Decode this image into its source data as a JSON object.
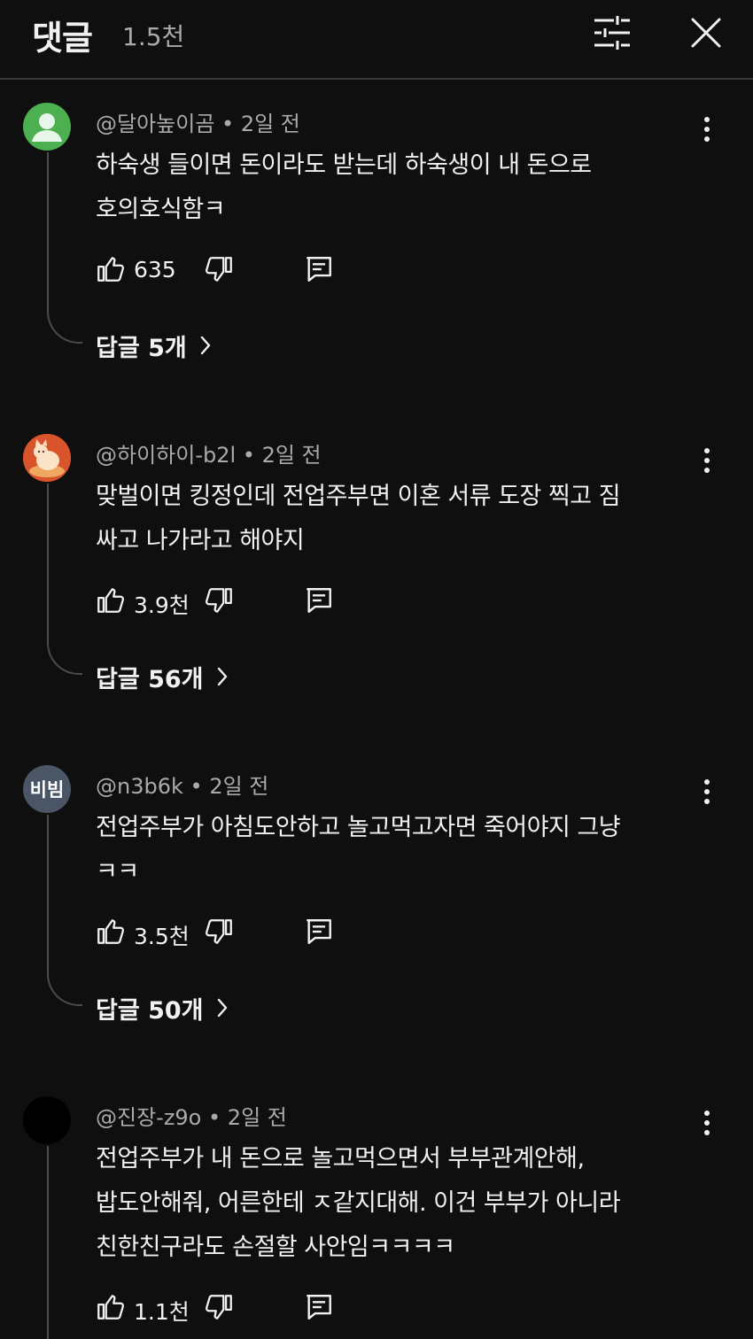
{
  "header": {
    "title": "댓글",
    "count": "1.5천",
    "filter_icon": "sliders-icon",
    "close_icon": "close-icon"
  },
  "comments": [
    {
      "avatar_color": "#4caf50",
      "avatar_kind": "default-person",
      "handle": "@달아높이곰",
      "time": "2일 전",
      "text_lines": [
        "하숙생 들이면 돈이라도 받는데 하숙생이 내 돈으로",
        "호의호식함ㅋ"
      ],
      "likes": "635",
      "replies": "답글 5개"
    },
    {
      "avatar_color": "#d9542b",
      "avatar_kind": "cat-photo",
      "handle": "@하이하이-b2l",
      "time": "2일 전",
      "text_lines": [
        "맞벌이면 킹정인데 전업주부면 이혼 서류 도장 찍고 짐",
        "싸고 나가라고 해야지"
      ],
      "likes": "3.9천",
      "replies": "답글 56개"
    },
    {
      "avatar_color": "#4a5666",
      "avatar_kind": "text",
      "avatar_text": "비빔",
      "handle": "@n3b6k",
      "time": "2일 전",
      "text_lines": [
        "전업주부가 아침도안하고 놀고먹고자면 죽어야지 그냥",
        "ㅋㅋ"
      ],
      "likes": "3.5천",
      "replies": "답글 50개"
    },
    {
      "avatar_color": "#000000",
      "avatar_kind": "black",
      "handle": "@진장-z9o",
      "time": "2일 전",
      "text_lines": [
        "전업주부가 내 돈으로 놀고먹으면서 부부관계안해,",
        "밥도안해줘, 어른한테 ㅈ같지대해. 이건 부부가 아니라",
        "친한친구라도 손절할 사안임ㅋㅋㅋㅋ"
      ],
      "likes": "1.1천"
    }
  ]
}
